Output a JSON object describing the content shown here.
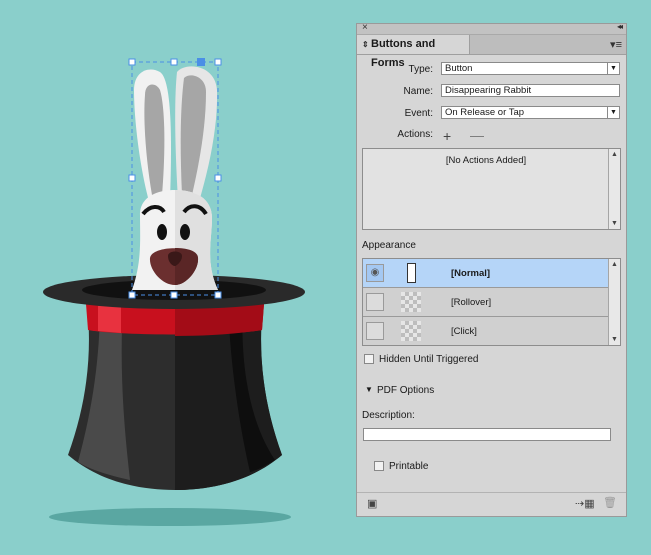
{
  "panel": {
    "title": "Buttons and Forms",
    "close_glyph": "×",
    "collapse_glyph": "◂◂",
    "tab_arrow_glyph": "⌃⌄",
    "menu_glyph": "▾≡",
    "type_label": "Type:",
    "type_value": "Button",
    "name_label": "Name:",
    "name_value": "Disappearing Rabbit",
    "event_label": "Event:",
    "event_value": "On Release or Tap",
    "actions_label": "Actions:",
    "add_action_glyph": "+",
    "remove_action_glyph": "—",
    "no_actions_text": "[No Actions Added]",
    "appearance_label": "Appearance",
    "appearance_states": [
      {
        "name": "[Normal]",
        "selected": true,
        "visible": true
      },
      {
        "name": "[Rollover]",
        "selected": false,
        "visible": false
      },
      {
        "name": "[Click]",
        "selected": false,
        "visible": false
      }
    ],
    "hidden_until_triggered_label": "Hidden Until Triggered",
    "hidden_until_triggered_checked": false,
    "pdf_options_label": "PDF Options",
    "description_label": "Description:",
    "description_value": "",
    "printable_label": "Printable",
    "printable_checked": false,
    "eye_glyph": "◉",
    "scroll_up_glyph": "▲",
    "scroll_down_glyph": "▼",
    "dropdown_glyph": "▼",
    "disclosure_glyph": "▼",
    "preview_glyph": "▣",
    "convert_glyph": "⇢▦",
    "trash_glyph": "🗑"
  },
  "colors": {
    "background": "#8acfcb",
    "selection": "#b5d5f8",
    "hat_band": "#c8101e"
  }
}
